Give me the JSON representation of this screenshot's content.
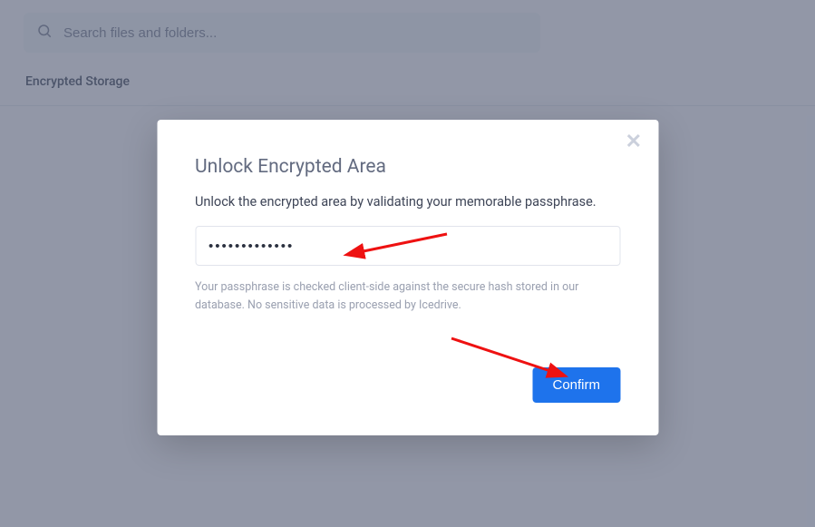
{
  "search": {
    "placeholder": "Search files and folders..."
  },
  "page": {
    "label": "Encrypted Storage"
  },
  "modal": {
    "title": "Unlock Encrypted Area",
    "description": "Unlock the encrypted area by validating your memorable passphrase.",
    "passphrase_value": "•••••••••••••",
    "helper": "Your passphrase is checked client-side against the secure hash stored in our database. No sensitive data is processed by Icedrive.",
    "confirm_label": "Confirm",
    "close_glyph": "✕"
  }
}
